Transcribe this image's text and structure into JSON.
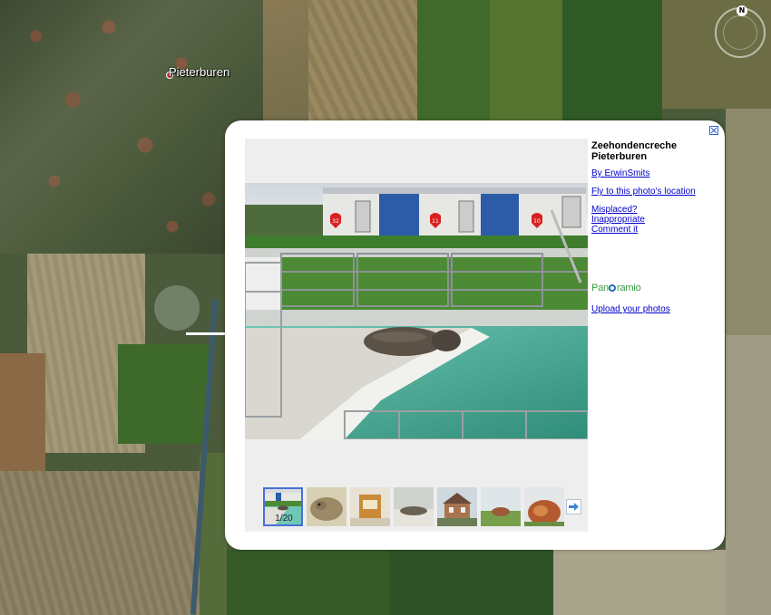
{
  "map": {
    "place_label": "Pieterburen",
    "compass_label": "N"
  },
  "balloon": {
    "title": "Zeehondencreche Pieterburen",
    "author_link": "By ErwinSmits",
    "fly_link": "Fly to this photo's location",
    "misplaced_link": "Misplaced?",
    "inappropriate_link": "Inappropriate",
    "comment_link": "Comment it",
    "logo_text_pre": "Pan",
    "logo_text_post": "ramio",
    "upload_link": "Upload your photos",
    "close_icon": "close-icon",
    "photo_container_labels": [
      "32",
      "11",
      "10"
    ],
    "thumbnails": [
      {
        "name": "thumb-1",
        "selected": true
      },
      {
        "name": "thumb-2",
        "selected": false
      },
      {
        "name": "thumb-3",
        "selected": false
      },
      {
        "name": "thumb-4",
        "selected": false
      },
      {
        "name": "thumb-5",
        "selected": false
      },
      {
        "name": "thumb-6",
        "selected": false
      },
      {
        "name": "thumb-7",
        "selected": false
      }
    ],
    "counter": "1/20",
    "next_icon": "arrow-right-icon"
  },
  "colors": {
    "link": "#0000cc",
    "logo_green": "#39a03c",
    "logo_blue": "#1d6fb7",
    "selection_border": "#4a6fd6"
  }
}
